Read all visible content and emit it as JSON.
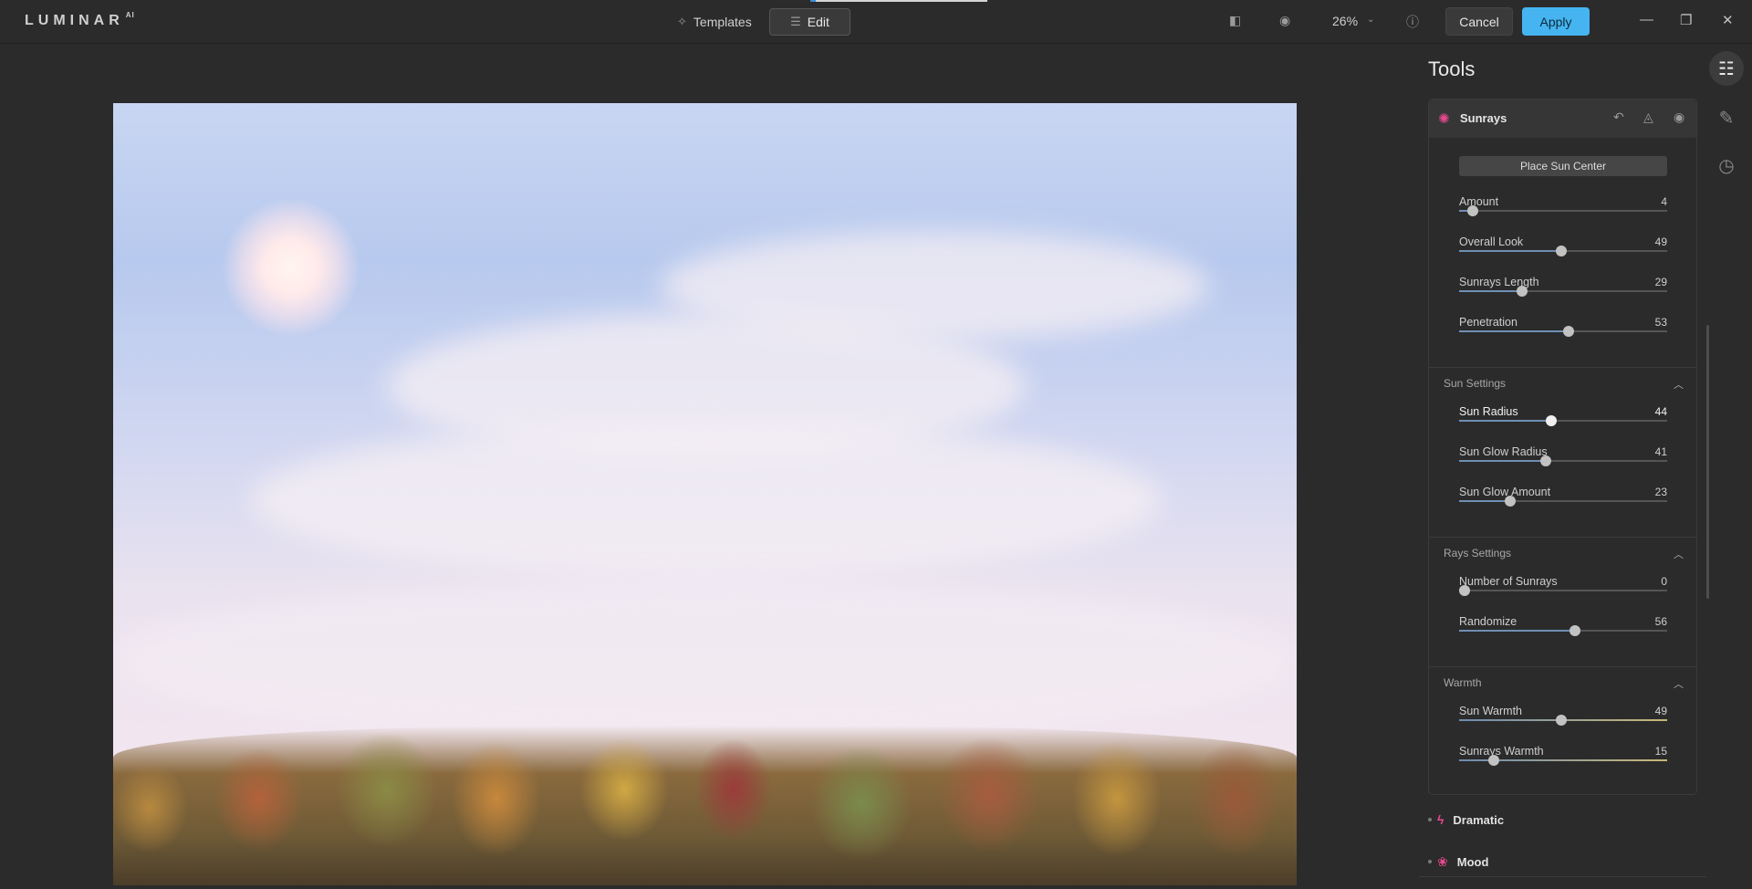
{
  "app": {
    "logo": "LUMINAR",
    "logo_suffix": "AI"
  },
  "modes": {
    "templates": "Templates",
    "edit": "Edit"
  },
  "toolbar": {
    "zoom": "26%",
    "cancel": "Cancel",
    "apply": "Apply"
  },
  "panel": {
    "title": "Tools",
    "tool_name": "Sunrays",
    "place_sun": "Place Sun Center",
    "sliders_main": [
      {
        "label": "Amount",
        "value": "4",
        "pct": 4
      },
      {
        "label": "Overall Look",
        "value": "49",
        "pct": 49
      },
      {
        "label": "Sunrays Length",
        "value": "29",
        "pct": 29
      },
      {
        "label": "Penetration",
        "value": "53",
        "pct": 53
      }
    ],
    "sun_settings": {
      "title": "Sun Settings",
      "sliders": [
        {
          "label": "Sun Radius",
          "value": "44",
          "pct": 44
        },
        {
          "label": "Sun Glow Radius",
          "value": "41",
          "pct": 41
        },
        {
          "label": "Sun Glow Amount",
          "value": "23",
          "pct": 23
        }
      ]
    },
    "rays_settings": {
      "title": "Rays Settings",
      "sliders": [
        {
          "label": "Number of Sunrays",
          "value": "0",
          "pct": 0
        },
        {
          "label": "Randomize",
          "value": "56",
          "pct": 56
        }
      ]
    },
    "warmth": {
      "title": "Warmth",
      "sliders": [
        {
          "label": "Sun Warmth",
          "value": "49",
          "pct": 49
        },
        {
          "label": "Sunrays Warmth",
          "value": "15",
          "pct": 15
        }
      ]
    },
    "other_tools": [
      "Dramatic",
      "Mood"
    ]
  },
  "colors": {
    "accent": "#45b4f0",
    "tool_icon": "#e6498e",
    "slider_fill": "#6f8fb4"
  }
}
